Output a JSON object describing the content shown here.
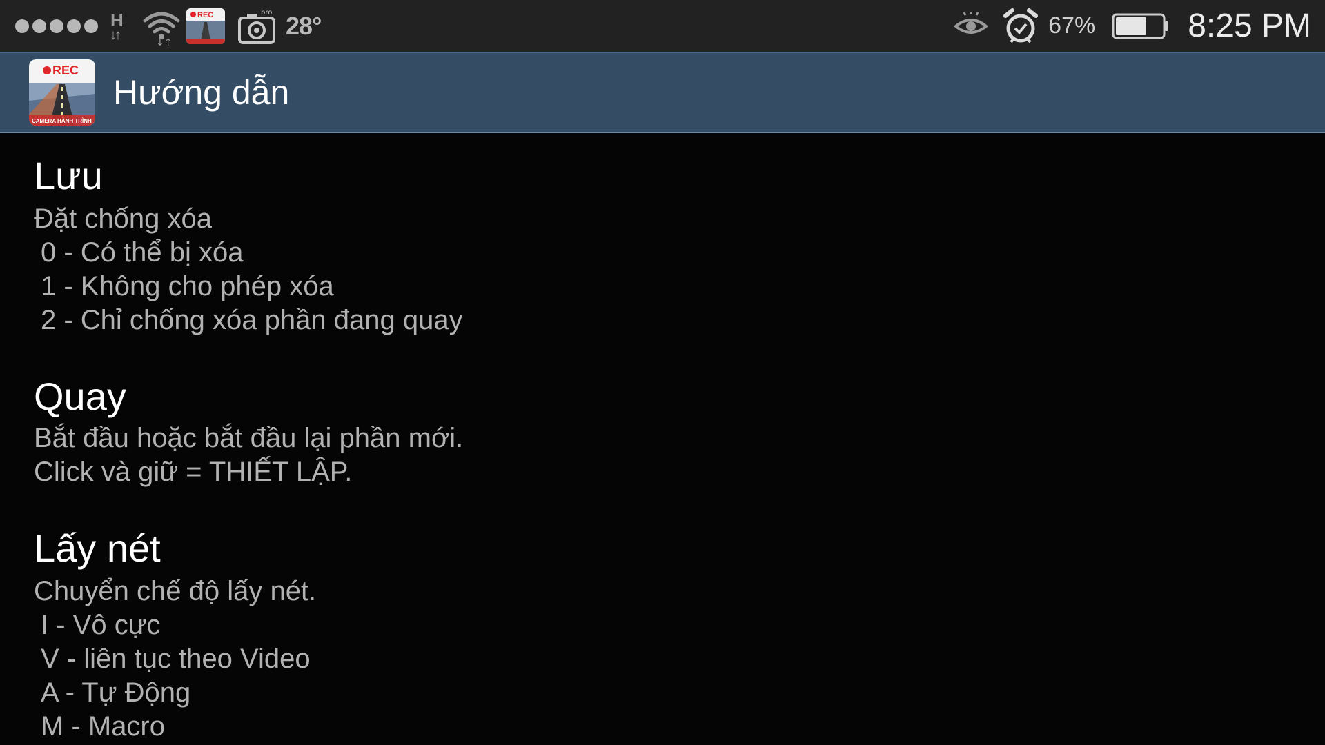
{
  "status_bar": {
    "network_type": "H",
    "temperature": "28°",
    "battery_percent": "67%",
    "battery_level": 0.67,
    "time": "8:25 PM",
    "icons": [
      "signal-icon",
      "network-h-icon",
      "wifi-icon",
      "rec-app-icon",
      "camera-pro-icon",
      "eye-icon",
      "alarm-icon",
      "battery-icon"
    ],
    "camera_badge": "pro"
  },
  "action_bar": {
    "app_icon_label": "REC",
    "app_icon_caption": "CAMERA HÀNH TRÌNH",
    "title": "Hướng dẫn"
  },
  "sections": [
    {
      "title": "Lưu",
      "lines": [
        "Đặt chống xóa",
        "0 - Có thể bị xóa",
        "1 - Không cho phép xóa",
        "2 - Chỉ chống xóa phần đang quay"
      ]
    },
    {
      "title": "Quay",
      "lines": [
        "Bắt đầu hoặc bắt đầu lại phần mới.",
        "Click và giữ = THIẾT LẬP."
      ]
    },
    {
      "title": "Lấy nét",
      "lines": [
        "Chuyển chế độ lấy nét.",
        "I - Vô cực",
        "V - liên tục theo Video",
        "A - Tự Động",
        "M - Macro"
      ]
    }
  ],
  "colors": {
    "status_bar_bg": "#222222",
    "action_bar_bg": "#344c64",
    "content_bg": "#050505",
    "heading": "#ffffff",
    "body_text": "#b2b2b2",
    "rec_red": "#e0262a"
  }
}
